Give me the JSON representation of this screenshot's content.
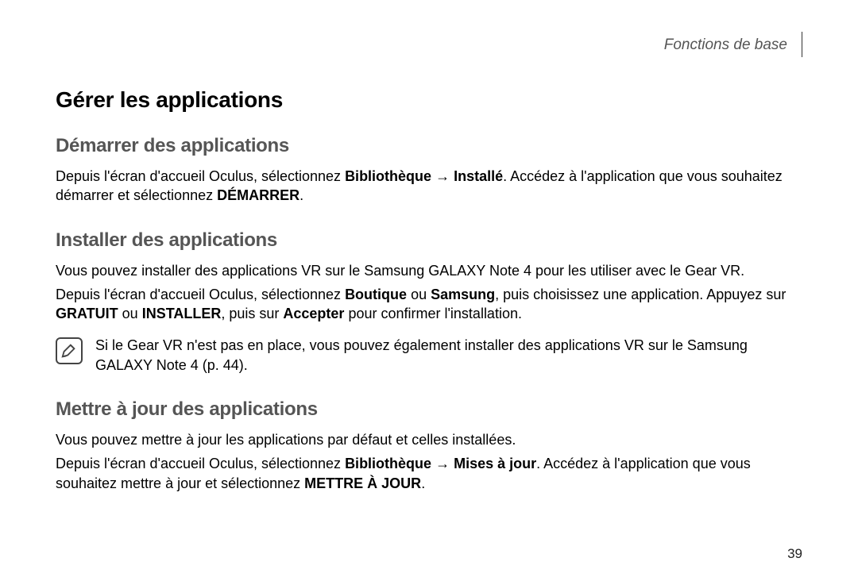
{
  "header": {
    "section_name": "Fonctions de base"
  },
  "title": "Gérer les applications",
  "sections": {
    "demarrer": {
      "heading": "Démarrer des applications",
      "p1_pre": "Depuis l'écran d'accueil Oculus, sélectionnez ",
      "p1_b1": "Bibliothèque",
      "p1_arrow": " → ",
      "p1_b2": "Installé",
      "p1_mid": ". Accédez à l'application que vous souhaitez démarrer et sélectionnez ",
      "p1_b3": "DÉMARRER",
      "p1_end": "."
    },
    "installer": {
      "heading": "Installer des applications",
      "p1": "Vous pouvez installer des applications VR sur le Samsung GALAXY Note 4 pour les utiliser avec le Gear VR.",
      "p2_pre": "Depuis l'écran d'accueil Oculus, sélectionnez ",
      "p2_b1": "Boutique",
      "p2_mid1": " ou ",
      "p2_b2": "Samsung",
      "p2_mid2": ", puis choisissez une application. Appuyez sur ",
      "p2_b3": "GRATUIT",
      "p2_mid3": " ou ",
      "p2_b4": "INSTALLER",
      "p2_mid4": ", puis sur ",
      "p2_b5": "Accepter",
      "p2_end": " pour confirmer l'installation.",
      "note": "Si le Gear VR n'est pas en place, vous pouvez également installer des applications VR sur le Samsung GALAXY Note 4 (p. 44)."
    },
    "mettre_a_jour": {
      "heading": "Mettre à jour des applications",
      "p1": "Vous pouvez mettre à jour les applications par défaut et celles installées.",
      "p2_pre": "Depuis l'écran d'accueil Oculus, sélectionnez ",
      "p2_b1": "Bibliothèque",
      "p2_arrow": " → ",
      "p2_b2": "Mises à jour",
      "p2_mid": ". Accédez à l'application que vous souhaitez mettre à jour et sélectionnez ",
      "p2_b3": "METTRE À JOUR",
      "p2_end": "."
    }
  },
  "page_number": "39"
}
